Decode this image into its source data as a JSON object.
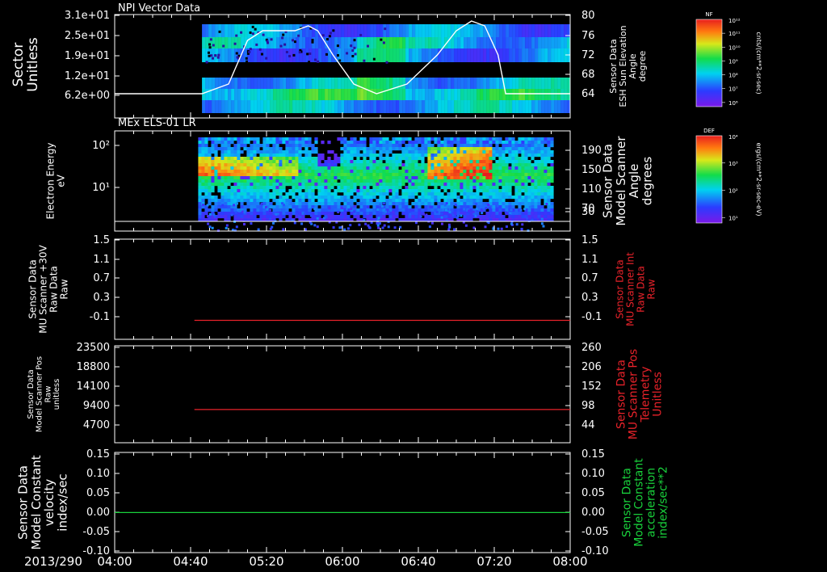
{
  "colors": {
    "background": "#000000",
    "axis": "#ffffff",
    "red_trace": "#e8222a",
    "green_trace": "#19d23c",
    "white_trace": "#ffffff"
  },
  "date_label": "2013/290",
  "time_ticks": [
    "04:00",
    "04:40",
    "05:20",
    "06:00",
    "06:40",
    "07:20",
    "08:00"
  ],
  "colorbars": [
    {
      "name": "nf-colorbar",
      "header": "NF",
      "top_label": "10¹²",
      "tick_labels": [
        "10¹¹",
        "10¹⁰",
        "10⁹",
        "10⁸",
        "10⁷",
        "10⁶"
      ],
      "units": "cnts/(cm**2-sr-sec)"
    },
    {
      "name": "def-colorbar",
      "header": "DEF",
      "top_label": "10⁴",
      "tick_labels": [
        "10³",
        "10²",
        "10¹"
      ],
      "units": "ergs/(cm**2-sr-sec-eV)"
    }
  ],
  "chart_data": [
    {
      "type": "heatmap",
      "title": "NPI Vector Data",
      "ylabel_lines": [
        "Sector",
        "Unitless"
      ],
      "y_ticks": [
        "3.1e+01",
        "2.5e+01",
        "1.9e+01",
        "1.2e+01",
        "6.2e+00"
      ],
      "ylabel_right_lines": [
        "Sensor Data",
        "ESH Sun Elevation",
        "Angle",
        "degree"
      ],
      "y_ticks_right": [
        "80",
        "76",
        "72",
        "68",
        "64"
      ],
      "data_start": "04:46",
      "data_end": "08:00",
      "overlay_line": {
        "name": "ESH Sun Elevation",
        "y_unit": "degree",
        "points": [
          [
            "04:00",
            64
          ],
          [
            "04:46",
            64
          ],
          [
            "05:00",
            66
          ],
          [
            "05:10",
            75
          ],
          [
            "05:18",
            77
          ],
          [
            "05:35",
            77
          ],
          [
            "05:42",
            78
          ],
          [
            "05:47",
            77
          ],
          [
            "05:55",
            72
          ],
          [
            "06:06",
            66
          ],
          [
            "06:18",
            64
          ],
          [
            "06:34",
            66
          ],
          [
            "06:50",
            72
          ],
          [
            "07:00",
            77
          ],
          [
            "07:08",
            79
          ],
          [
            "07:15",
            78
          ],
          [
            "07:22",
            72
          ],
          [
            "07:26",
            64
          ],
          [
            "08:00",
            64
          ]
        ]
      }
    },
    {
      "type": "heatmap",
      "title": "MEx ELS-01 LR",
      "ylabel_lines": [
        "Electron Energy",
        "eV"
      ],
      "y_ticks": [
        "10²",
        "10¹"
      ],
      "ylabel_right_lines": [
        "Sensor Data",
        "Model Scanner",
        "Angle",
        "degrees"
      ],
      "y_ticks_right": [
        "190",
        "150",
        "110",
        "70",
        "30"
      ],
      "data_start": "04:44",
      "data_end": "07:51",
      "baseline_value": "~2 eV"
    },
    {
      "type": "line",
      "ylabel_lines": [
        "Sensor Data",
        "MU Scanner +30V",
        "Raw Data",
        "Raw"
      ],
      "y_ticks": [
        "1.5",
        "1.1",
        "0.7",
        "0.3",
        "-0.1"
      ],
      "ylabel_right_lines": [
        "Sensor Data",
        "MU Scanner Int",
        "Raw Data",
        "Raw"
      ],
      "y_ticks_right": [
        "1.5",
        "1.1",
        "0.7",
        "0.3",
        "-0.1"
      ],
      "ylim": [
        -0.35,
        1.5
      ],
      "series": [
        {
          "x": [
            "04:42",
            "08:00"
          ],
          "y": [
            0.0,
            0.0
          ]
        }
      ]
    },
    {
      "type": "line",
      "ylabel_lines": [
        "Sensor Data",
        "Model Scanner Pos",
        "Raw",
        "unitless"
      ],
      "y_ticks": [
        "23500",
        "18800",
        "14100",
        "9400",
        "4700"
      ],
      "ylabel_right_lines": [
        "Sensor Data",
        "MU Scanner Pos",
        "Telemetry",
        "Unitless"
      ],
      "y_ticks_right": [
        "260",
        "206",
        "152",
        "98",
        "44"
      ],
      "ylim": [
        0,
        23500
      ],
      "series": [
        {
          "x": [
            "04:42",
            "08:00"
          ],
          "y": [
            8050,
            8050
          ]
        }
      ]
    },
    {
      "type": "line",
      "ylabel_lines": [
        "Sensor Data",
        "Model Constant",
        "velocity",
        "index/sec"
      ],
      "y_ticks": [
        "0.15",
        "0.10",
        "0.05",
        "0.00",
        "-0.05",
        "-0.10"
      ],
      "ylabel_right_lines": [
        "Sensor Data",
        "Model Constant",
        "acceleration",
        "index/sec**2"
      ],
      "y_ticks_right": [
        "0.15",
        "0.10",
        "0.05",
        "0.00",
        "-0.05",
        "-0.10"
      ],
      "ylim": [
        -0.1,
        0.15
      ],
      "series": [
        {
          "x": [
            "04:00",
            "08:00"
          ],
          "y": [
            0.0,
            0.0
          ]
        }
      ]
    }
  ]
}
